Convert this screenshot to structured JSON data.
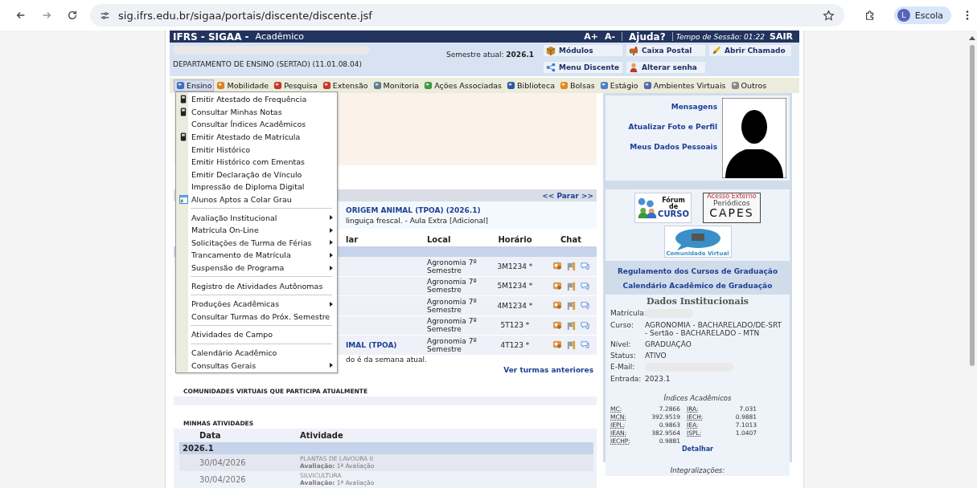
{
  "browser": {
    "url": "sig.ifrs.edu.br/sigaa/portais/discente/discente.jsf",
    "profile_initial": "L",
    "profile_name": "Escola"
  },
  "header": {
    "system": "IFRS - SIGAA -",
    "module": "Acadêmico",
    "font_up": "A+",
    "font_down": "A-",
    "help": "Ajuda?",
    "session": "Tempo de Sessão: 01:22",
    "logout": "SAIR"
  },
  "info": {
    "department": "DEPARTAMENTO DE ENSINO (SERTAO) (11.01.08.04)",
    "semester_label": "Semestre atual:",
    "semester": "2026.1",
    "shortcuts": [
      {
        "label": "Módulos",
        "kind": "box"
      },
      {
        "label": "Caixa Postal",
        "kind": "mailbox"
      },
      {
        "label": "Abrir Chamado",
        "kind": "pen"
      },
      {
        "label": "Menu Discente",
        "kind": "network"
      },
      {
        "label": "Alterar senha",
        "kind": "person"
      }
    ]
  },
  "menu_bar": [
    {
      "label": "Ensino",
      "selected": true
    },
    {
      "label": "Mobilidade",
      "selected": false
    },
    {
      "label": "Pesquisa",
      "selected": false
    },
    {
      "label": "Extensão",
      "selected": false
    },
    {
      "label": "Monitoria",
      "selected": false
    },
    {
      "label": "Ações Associadas",
      "selected": false
    },
    {
      "label": "Biblioteca",
      "selected": false
    },
    {
      "label": "Bolsas",
      "selected": false
    },
    {
      "label": "Estágio",
      "selected": false
    },
    {
      "label": "Ambientes Virtuais",
      "selected": false
    },
    {
      "label": "Outros",
      "selected": false
    }
  ],
  "dropdown": {
    "groups": [
      {
        "items": [
          {
            "label": "Emitir Atestado de Frequência",
            "kind": "device",
            "submenu": false
          },
          {
            "label": "Consultar Minhas Notas",
            "kind": "device",
            "submenu": false
          },
          {
            "label": "Consultar Índices Acadêmicos",
            "kind": "plain",
            "submenu": false
          },
          {
            "label": "Emitir Atestado de Matrícula",
            "kind": "device",
            "submenu": false
          },
          {
            "label": "Emitir Histórico",
            "kind": "plain",
            "submenu": false
          },
          {
            "label": "Emitir Histórico com Ementas",
            "kind": "plain",
            "submenu": false
          },
          {
            "label": "Emitir Declaração de Vínculo",
            "kind": "plain",
            "submenu": false
          },
          {
            "label": "Impressão de Diploma Digital",
            "kind": "plain",
            "submenu": false
          },
          {
            "label": "Alunos Aptos a Colar Grau",
            "kind": "grid",
            "submenu": false
          }
        ]
      },
      {
        "items": [
          {
            "label": "Avaliação Institucional",
            "kind": "plain",
            "submenu": true
          },
          {
            "label": "Matrícula On-Line",
            "kind": "plain",
            "submenu": true
          },
          {
            "label": "Solicitações de Turma de Férias",
            "kind": "plain",
            "submenu": true
          },
          {
            "label": "Trancamento de Matrícula",
            "kind": "plain",
            "submenu": true
          },
          {
            "label": "Suspensão de Programa",
            "kind": "plain",
            "submenu": true
          }
        ]
      },
      {
        "items": [
          {
            "label": "Registro de Atividades Autônomas",
            "kind": "plain",
            "submenu": false
          }
        ]
      },
      {
        "items": [
          {
            "label": "Produções Acadêmicas",
            "kind": "plain",
            "submenu": true
          },
          {
            "label": "Consultar Turmas do Próx. Semestre",
            "kind": "plain",
            "submenu": false
          }
        ]
      },
      {
        "items": [
          {
            "label": "Atividades de Campo",
            "kind": "plain",
            "submenu": false
          }
        ]
      },
      {
        "items": [
          {
            "label": "Calendário Acadêmico",
            "kind": "plain",
            "submenu": false
          },
          {
            "label": "Consultas Gerais",
            "kind": "plain",
            "submenu": true
          }
        ]
      }
    ]
  },
  "notice": {
    "nav": "<< Parar >>",
    "title": "ORIGEM ANIMAL (TPOA) (2026.1)",
    "detail": "linguiça frescal. - Aula Extra [Adicional]"
  },
  "classes": {
    "columns": [
      "lar",
      "Local",
      "Horário",
      "Chat"
    ],
    "rows": [
      {
        "local": "Agronomia 7º Semestre",
        "time": "3M1234 *"
      },
      {
        "local": "Agronomia 7º Semestre",
        "time": "5M1234 *"
      },
      {
        "local": "Agronomia 7º Semestre",
        "time": "4M1234 *"
      },
      {
        "local": "Agronomia 7º Semestre",
        "time": "5T123 *"
      },
      {
        "name": "IMAL (TPOA)",
        "local": "Agronomia 7º Semestre",
        "time": "4T123 *"
      }
    ],
    "note": "do é da semana atual.",
    "more": "Ver turmas anteriores"
  },
  "communities": {
    "title": "COMUNIDADES VIRTUAIS QUE PARTICIPA ATUALMENTE"
  },
  "activities": {
    "title": "MINHAS ATIVIDADES",
    "columns": [
      "Data",
      "Atividade"
    ],
    "group": "2026.1",
    "rows": [
      {
        "date": "30/04/2026",
        "course": "PLANTAS DE LAVOURA II",
        "detail": "**Avaliação:** 1ª Avaliação"
      },
      {
        "date": "30/04/2026",
        "course": "SILVICULTURA",
        "detail": "**Avaliação:** 1ª Avaliação"
      }
    ]
  },
  "profile": {
    "links": [
      "Mensagens",
      "Atualizar Foto e Perfil",
      "Meus Dados Pessoais"
    ]
  },
  "logos": {
    "forum": [
      "Fórum",
      "de",
      "CURSO"
    ],
    "capes": [
      "Acesso Externo",
      "Periódicos",
      "CAPES"
    ],
    "community": "Comunidade Virtual"
  },
  "links": [
    "Regulamento dos Cursos de Graduação",
    "Calendário Acadêmico de Graduação"
  ],
  "institutional": {
    "title": "Dados Institucionais",
    "fields": [
      {
        "label": "Matrícula:",
        "redacted": true
      },
      {
        "label": "Curso:",
        "value": "AGRONOMIA - BACHARELADO/DE-SRT - Sertão - BACHARELADO - MTN",
        "redacted": false
      },
      {
        "label": "Nível:",
        "value": "GRADUAÇÃO",
        "redacted": false
      },
      {
        "label": "Status:",
        "value": "ATIVO",
        "redacted": false
      },
      {
        "label": "E-Mail:",
        "redacted": true
      },
      {
        "label": "Entrada:",
        "value": "2023.1",
        "redacted": false
      }
    ],
    "indices_title": "Índices Acadêmicos",
    "indices": [
      {
        "label": "MC:",
        "value": "7.2866"
      },
      {
        "label": "IRA:",
        "value": "7.031"
      },
      {
        "label": "MCN:",
        "value": "392.9519"
      },
      {
        "label": "IECH:",
        "value": "0.9881"
      },
      {
        "label": "IEPL:",
        "value": "0.9863"
      },
      {
        "label": "IEA:",
        "value": "7.1013"
      },
      {
        "label": "IEAN:",
        "value": "382.9564"
      },
      {
        "label": "ISPL:",
        "value": "1.0407"
      },
      {
        "label": "IECHP:",
        "value": "0.9881"
      }
    ],
    "more": "Detalhar",
    "integration": "Integralizações:"
  }
}
